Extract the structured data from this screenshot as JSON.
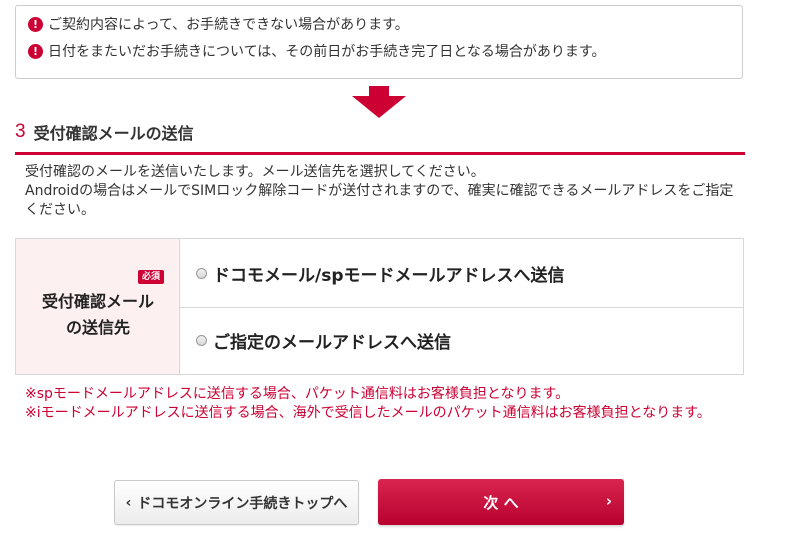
{
  "notices": [
    {
      "icon": "exclamation-circle-icon",
      "text": "ご契約内容によって、お手続きできない場合があります。"
    },
    {
      "icon": "exclamation-circle-icon",
      "text": "日付をまたいだお手続きについては、その前日がお手続き完了日となる場合があります。"
    }
  ],
  "section": {
    "number": "3",
    "title": "受付確認メールの送信",
    "description": [
      "受付確認のメールを送信いたします。メール送信先を選択してください。",
      "Androidの場合はメールでSIMロック解除コードが送付されますので、確実に確認できるメールアドレスをご指定ください。"
    ]
  },
  "form": {
    "required_badge": "必須",
    "label_line1": "受付確認メール",
    "label_line2": "の送信先",
    "options": [
      {
        "label": "ドコモメール/spモードメールアドレスへ送信",
        "selected": false
      },
      {
        "label": "ご指定のメールアドレスへ送信",
        "selected": false
      }
    ]
  },
  "notes": [
    "※spモードメールアドレスに送信する場合、パケット通信料はお客様負担となります。",
    "※iモードメールアドレスに送信する場合、海外で受信したメールのパケット通信料はお客様負担となります。"
  ],
  "buttons": {
    "back_chevron": "‹",
    "back_label": "ドコモオンライン手続きトップへ",
    "next_label": "次 へ",
    "next_chevron": "›"
  },
  "colors": {
    "accent": "#cc0033",
    "label_bg": "#fdf0f0"
  }
}
